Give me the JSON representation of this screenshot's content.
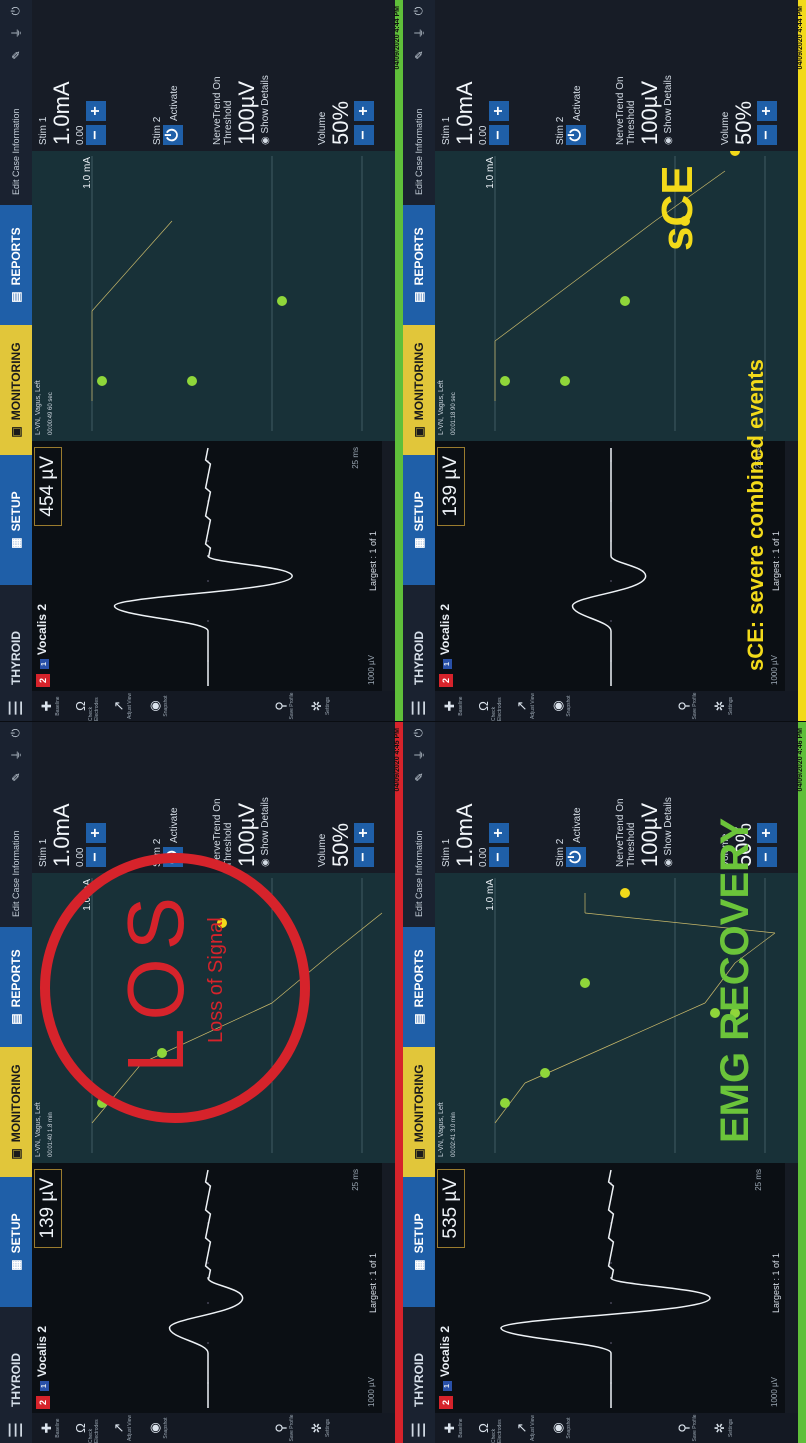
{
  "common": {
    "case": "THYROID",
    "tabs": {
      "setup": "SETUP",
      "monitoring": "MONITORING",
      "reports": "REPORTS"
    },
    "edit_case": "Edit Case Information",
    "nerve": "L-VN, Vagus, Left",
    "channel": "Vocalis 2",
    "channel_num": "2",
    "channel_badge": "1",
    "scale": "1000 µV",
    "time": "25 ms",
    "largest": "Largest : 1 of 1",
    "stim1_label": "Stim 1",
    "stim1_value": "1.0mA",
    "stim1_sub": "0.00",
    "stim2_label": "Stim 2",
    "activate": "Activate",
    "nervetrend": "NerveTrend On",
    "threshold_label": "Threshold",
    "threshold_value": "100µV",
    "show_details": "Show Details",
    "volume_label": "Volume",
    "volume_value": "50%",
    "trend_ma": "1.0 mA",
    "side": [
      "Baseline",
      "Check Electrodes",
      "Adjust View",
      "Snapshot",
      "Save Profile",
      "Settings"
    ]
  },
  "panels": [
    {
      "amp": "454 µV",
      "timer": "00:00:49  60 sec",
      "status_date": "04/09/2020 4:44 PM",
      "status_color": "#5fbf3a",
      "overlay": ""
    },
    {
      "amp": "139 µV",
      "timer": "00:01:18  90 sec",
      "status_date": "04/09/2020 4:44 PM",
      "status_color": "#f2da1a",
      "overlay": "sCE",
      "caption": "sCE: severe combined events"
    },
    {
      "amp": "139 µV",
      "timer": "00:01:40  1.8 min",
      "status_date": "04/09/2020 4:45 PM",
      "status_color": "#d6232b",
      "overlay": "LOS",
      "caption": "Loss of Signal"
    },
    {
      "amp": "535 µV",
      "timer": "00:02:41  3.0 min",
      "status_date": "04/09/2020 4:46 PM",
      "status_color": "#5fbf3a",
      "overlay": "EMG RECOVERY"
    }
  ]
}
